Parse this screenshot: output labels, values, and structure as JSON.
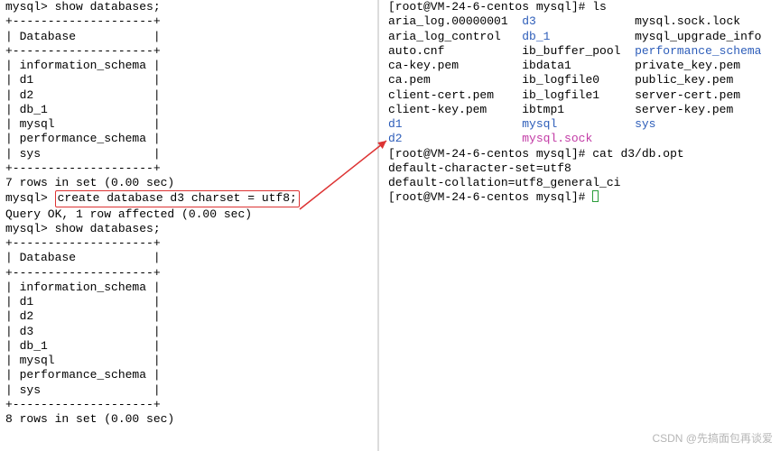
{
  "left": {
    "prompt": "mysql>",
    "cmd_show1": "show databases;",
    "table1_border_top": "+--------------------+",
    "table1_header": "| Database           |",
    "table1_border_mid": "+--------------------+",
    "table1_rows": [
      "| information_schema |",
      "| d1                 |",
      "| d2                 |",
      "| db_1               |",
      "| mysql              |",
      "| performance_schema |",
      "| sys                |"
    ],
    "table1_border_bot": "+--------------------+",
    "result1": "7 rows in set (0.00 sec)",
    "cmd_create": "create database d3 charset = utf8;",
    "create_ok": "Query OK, 1 row affected (0.00 sec)",
    "cmd_show2": "show databases;",
    "table2_border_top": "+--------------------+",
    "table2_header": "| Database           |",
    "table2_border_mid": "+--------------------+",
    "table2_rows": [
      "| information_schema |",
      "| d1                 |",
      "| d2                 |",
      "| d3                 |",
      "| db_1               |",
      "| mysql              |",
      "| performance_schema |",
      "| sys                |"
    ],
    "table2_border_bot": "+--------------------+",
    "result2": "8 rows in set (0.00 sec)"
  },
  "right": {
    "shell_prompt": "[root@VM-24-6-centos mysql]#",
    "cmd_ls": "ls",
    "ls_rows": [
      {
        "c1": "aria_log.00000001",
        "c1c": "",
        "c2": "d3",
        "c2c": "blue",
        "c3": "mysql.sock.lock",
        "c3c": ""
      },
      {
        "c1": "aria_log_control",
        "c1c": "",
        "c2": "db_1",
        "c2c": "blue",
        "c3": "mysql_upgrade_info",
        "c3c": ""
      },
      {
        "c1": "auto.cnf",
        "c1c": "",
        "c2": "ib_buffer_pool",
        "c2c": "",
        "c3": "performance_schema",
        "c3c": "blue"
      },
      {
        "c1": "ca-key.pem",
        "c1c": "",
        "c2": "ibdata1",
        "c2c": "",
        "c3": "private_key.pem",
        "c3c": ""
      },
      {
        "c1": "ca.pem",
        "c1c": "",
        "c2": "ib_logfile0",
        "c2c": "",
        "c3": "public_key.pem",
        "c3c": ""
      },
      {
        "c1": "client-cert.pem",
        "c1c": "",
        "c2": "ib_logfile1",
        "c2c": "",
        "c3": "server-cert.pem",
        "c3c": ""
      },
      {
        "c1": "client-key.pem",
        "c1c": "",
        "c2": "ibtmp1",
        "c2c": "",
        "c3": "server-key.pem",
        "c3c": ""
      },
      {
        "c1": "d1",
        "c1c": "blue",
        "c2": "mysql",
        "c2c": "blue",
        "c3": "sys",
        "c3c": "blue"
      },
      {
        "c1": "d2",
        "c1c": "blue",
        "c2": "mysql.sock",
        "c2c": "magenta",
        "c3": "",
        "c3c": ""
      }
    ],
    "ls_col_widths": [
      19,
      16,
      20
    ],
    "cmd_cat": "cat d3/db.opt",
    "cat_out1": "default-character-set=utf8",
    "cat_out2": "default-collation=utf8_general_ci"
  },
  "watermark": "CSDN @先搞面包再谈爱"
}
